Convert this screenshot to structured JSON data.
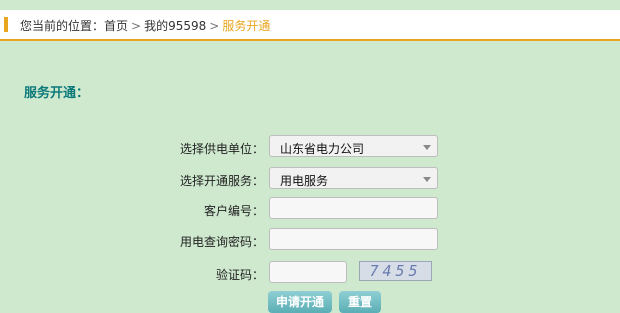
{
  "breadcrumb": {
    "prefix": "您当前的位置：",
    "items": [
      "首页",
      "我的95598",
      "服务开通"
    ],
    "separator": ">"
  },
  "section_title": "服务开通：",
  "form": {
    "supplier": {
      "label": "选择供电单位：",
      "value": "山东省电力公司"
    },
    "service": {
      "label": "选择开通服务：",
      "value": "用电服务"
    },
    "customer_no": {
      "label": "客户编号：",
      "value": ""
    },
    "query_password": {
      "label": "用电查询密码：",
      "value": ""
    },
    "captcha": {
      "label": "验证码：",
      "value": "",
      "image_text": "7455"
    }
  },
  "buttons": {
    "submit": "申请开通",
    "reset": "重置"
  },
  "colors": {
    "background": "#cfe9cf",
    "accent": "#e8a520",
    "title": "#0d7a7a"
  }
}
